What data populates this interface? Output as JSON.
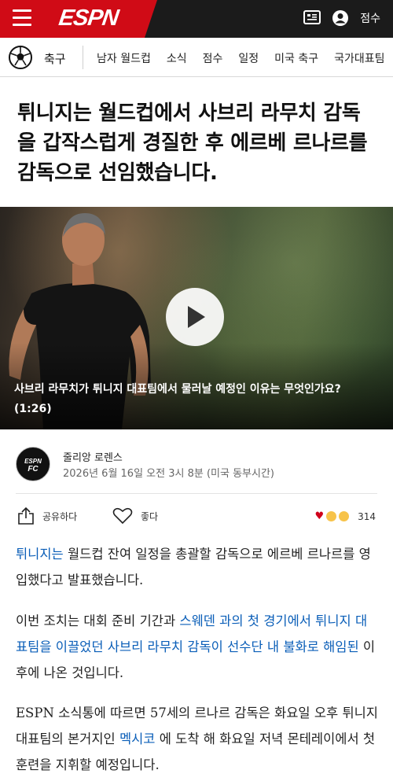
{
  "header": {
    "logo": "ESPN",
    "scores_label": "점수",
    "brand_color": "#d00b16"
  },
  "sport_nav": {
    "sport": "축구",
    "items": [
      "남자 월드컵",
      "소식",
      "점수",
      "일정",
      "미국 축구",
      "국가대표팀"
    ]
  },
  "article": {
    "headline": "튀니지는 월드컵에서 사브리 라무치 감독을 갑작스럽게 경질한 후 에르베 르나르를 감독으로 선임했습니다.",
    "video": {
      "caption": "사브리 라무치가 튀니지 대표팀에서 물러날 예정인 이유는 무엇인가요? (1:26)"
    },
    "byline": {
      "avatar_text": "ESPN",
      "avatar_sub": "FC",
      "author": "줄리앙 로렌스",
      "datetime": "2026년 6월 16일 오전 3시 8분 (미국 동부시간)"
    },
    "actions": {
      "share": "공유하다",
      "like": "좋다",
      "reaction_count": "314"
    },
    "p1": {
      "link": "튀니지는",
      "text": " 월드컵 잔여 일정을 총괄할 감독으로 에르베 르나르를 영입했다고 발표했습니다."
    },
    "p2": {
      "lead": "이번 조치는 대회 준비 기간과 ",
      "link": "스웨덴 과의 첫 경기에서 튀니지 대표팀을 이끌었던 사브리 라무치 감독이 선수단 내 불화로 해임된",
      "tail": " 이후에 나온 것입니다."
    },
    "p3": {
      "lead": "ESPN 소식통에 따르면 57세의 르나르 감독은 화요일 오후 튀니지 대표팀의 본거지인 ",
      "link": "멕시코",
      "tail": " 에 도착 해 화요일 저녁 몬테레이에서 첫 훈련을 지휘할 예정입니다."
    }
  },
  "colors": {
    "link": "#0a5eb8",
    "topbar": "#1b1b1b"
  }
}
